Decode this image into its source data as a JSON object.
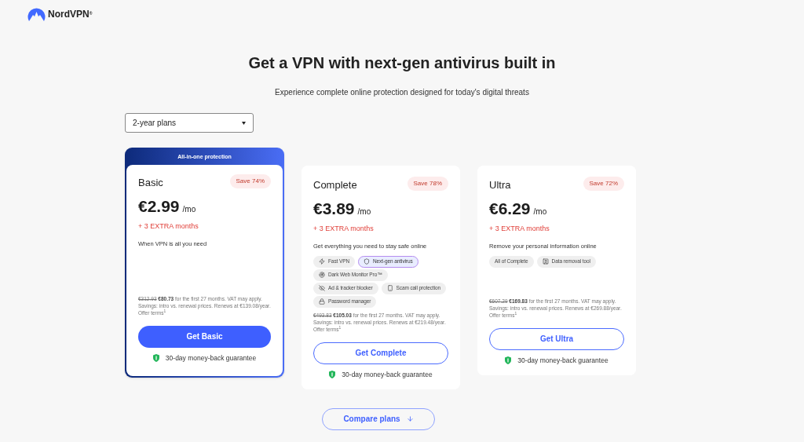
{
  "brand": {
    "name": "NordVPN",
    "mark": "®"
  },
  "heading": "Get a VPN with next-gen antivirus built in",
  "subheading": "Experience complete online protection designed for today's digital threats",
  "plan_select": {
    "value": "2-year plans"
  },
  "plans": [
    {
      "name": "Basic",
      "featured": true,
      "banner": "All-in-one protection",
      "save": "Save 74%",
      "price": "€2.99",
      "unit": "/mo",
      "extra": "+ 3 EXTRA months",
      "description": "When VPN is all you need",
      "old_price": "€312.93",
      "new_price": "€80.73",
      "note": "for the first 27 months. VAT may apply. Savings: intro vs. renewal prices. Renews at €139.08/year.",
      "terms": "Offer terms$^{1}$",
      "button": "Get Basic",
      "guarantee": "30-day money-back guarantee"
    },
    {
      "name": "Complete",
      "featured": false,
      "save": "Save 78%",
      "price": "€3.89",
      "unit": "/mo",
      "extra": "+ 3 EXTRA months",
      "description": "Get everything you need to stay safe online",
      "features": [
        {
          "label": "Fast VPN",
          "kind": "bolt",
          "highlighted": false
        },
        {
          "label": "Next-gen antivirus",
          "kind": "shield",
          "highlighted": true
        },
        {
          "label": "Dark Web Monitor Pro™",
          "kind": "radar",
          "highlighted": false
        },
        {
          "label": "Ad & tracker blocker",
          "kind": "eye-off",
          "highlighted": false
        },
        {
          "label": "Scam call protection",
          "kind": "phone",
          "highlighted": false
        },
        {
          "label": "Password manager",
          "kind": "lock",
          "highlighted": false
        }
      ],
      "old_price": "€493.83",
      "new_price": "€105.03",
      "note": "for the first 27 months. VAT may apply. Savings: intro vs. renewal prices. Renews at €219.48/year.",
      "terms": "Offer terms$^{1}$",
      "button": "Get Complete",
      "guarantee": "30-day money-back guarantee"
    },
    {
      "name": "Ultra",
      "featured": false,
      "save": "Save 72%",
      "price": "€6.29",
      "unit": "/mo",
      "extra": "+ 3 EXTRA months",
      "description": "Remove your personal information online",
      "features": [
        {
          "label": "All of Complete",
          "kind": "text",
          "highlighted": false
        },
        {
          "label": "Data removal tool",
          "kind": "user",
          "highlighted": false
        }
      ],
      "old_price": "€607.29",
      "new_price": "€169.83",
      "note": "for the first 27 months. VAT may apply. Savings: intro vs. renewal prices. Renews at €269.88/year.",
      "terms": "Offer terms$^{1}$",
      "button": "Get Ultra",
      "guarantee": "30-day money-back guarantee"
    }
  ],
  "compare_button": "Compare plans"
}
